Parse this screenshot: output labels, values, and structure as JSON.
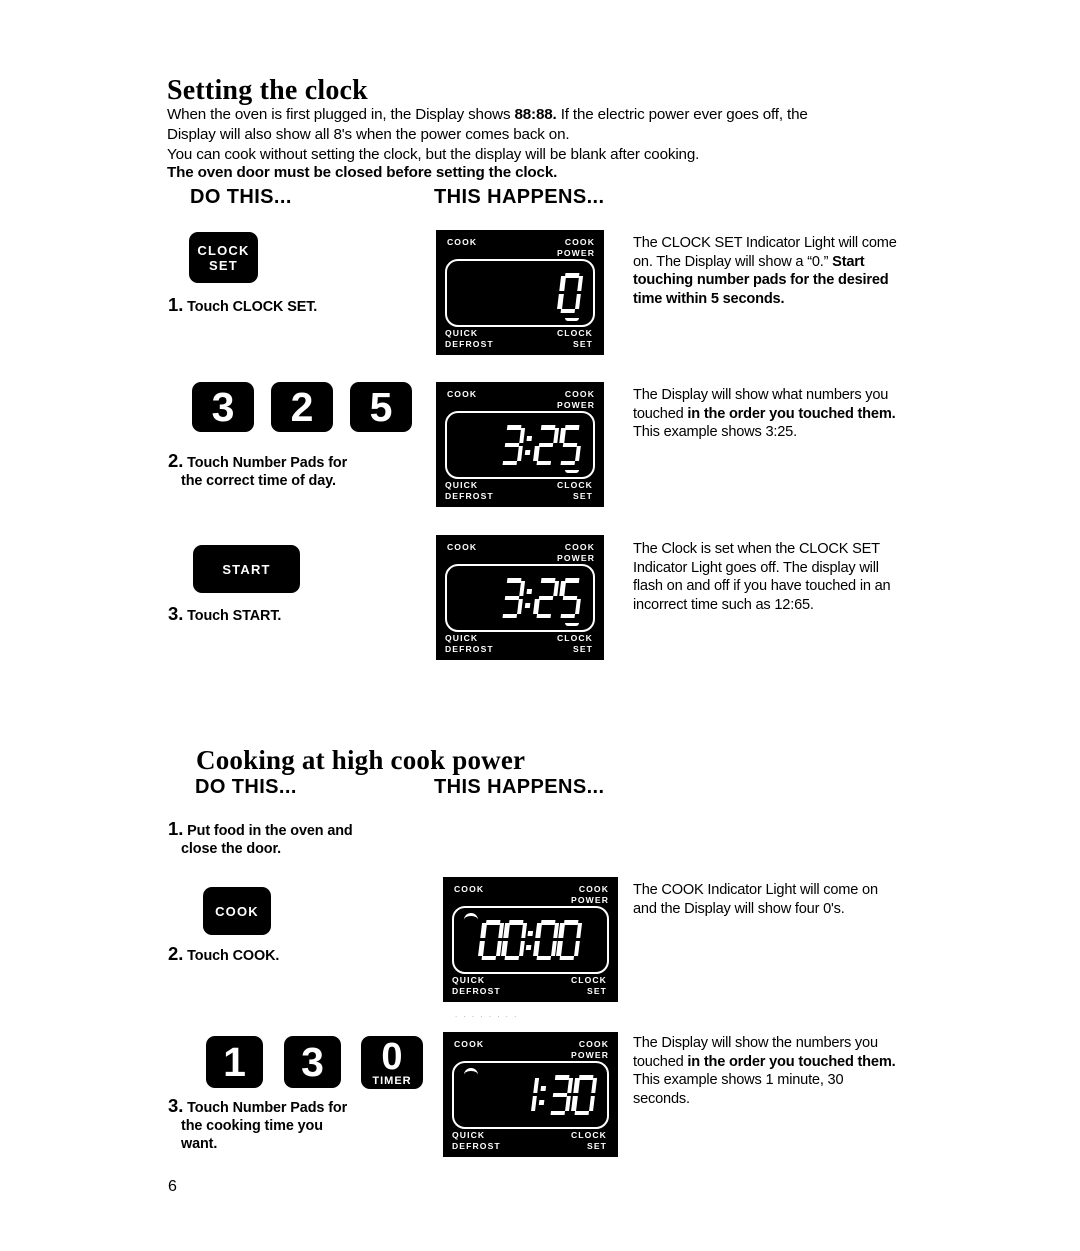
{
  "page": {
    "number": "6",
    "artifact_text": ". .   .     . .           .      .            ."
  },
  "sections": [
    {
      "id": "setting-the-clock",
      "title": "Setting the clock",
      "intro": [
        "When the oven is first plugged in, the Display shows 88:88. If the electric power ever goes off, the Display will also show all 8's when the power comes back on.",
        "You can cook without setting the clock, but the display will be blank after cooking.",
        "The oven door must be closed before setting the clock."
      ],
      "intro_bold_fragment": "88:88.",
      "columns": {
        "do_this": "DO THIS...",
        "this_happens": "THIS HAPPENS..."
      },
      "steps": [
        {
          "number": "1.",
          "caption": "Touch CLOCK SET.",
          "caption_line2": "",
          "caption_line3": "",
          "control": {
            "kind": "word-pad",
            "label": "CLOCK\nSET"
          },
          "display": {
            "top_left": "COOK",
            "top_right": "COOK\nPOWER",
            "bottom_left": "QUICK\nDEFROST",
            "bottom_right": "CLOCK\nSET",
            "readout": "0",
            "readout_mode": "right",
            "colon": true,
            "under_tick": true,
            "curve_tick": false
          },
          "happens": {
            "plain_1": "The CLOCK SET Indicator Light will come on. The Display will show a “0.” ",
            "bold_1": "Start touching number pads for the desired time within 5 seconds.",
            "plain_2": ""
          }
        },
        {
          "number": "2.",
          "caption": "Touch Number Pads for",
          "caption_line2": "the correct time of day.",
          "caption_line3": "",
          "control": {
            "kind": "digit-pads",
            "pads": [
              "3",
              "2",
              "5"
            ]
          },
          "display": {
            "top_left": "COOK",
            "top_right": "COOK\nPOWER",
            "bottom_left": "QUICK\nDEFROST",
            "bottom_right": "CLOCK\nSET",
            "readout": "3:25",
            "readout_mode": "right",
            "colon": true,
            "under_tick": true,
            "curve_tick": false
          },
          "happens": {
            "plain_1": "The Display will show what numbers you touched ",
            "bold_1": "in the order you touched them.",
            "plain_2": " This example shows 3:25."
          }
        },
        {
          "number": "3.",
          "caption": "Touch START.",
          "caption_line2": "",
          "caption_line3": "",
          "control": {
            "kind": "word-pad-wide",
            "label": "START"
          },
          "display": {
            "top_left": "COOK",
            "top_right": "COOK\nPOWER",
            "bottom_left": "QUICK\nDEFROST",
            "bottom_right": "CLOCK\nSET",
            "readout": "3:25",
            "readout_mode": "right",
            "colon": true,
            "under_tick": true,
            "curve_tick": false
          },
          "happens": {
            "plain_1": "The Clock is set when the CLOCK SET Indicator Light goes off. The display will flash on and off if you have touched in an incorrect time such as 12:65.",
            "bold_1": "",
            "plain_2": ""
          }
        }
      ]
    },
    {
      "id": "cooking-at-high-cook-power",
      "title": "Cooking at high cook power",
      "columns": {
        "do_this": "DO THIS...",
        "this_happens": "THIS HAPPENS..."
      },
      "steps": [
        {
          "number": "1.",
          "caption": "Put food in the oven and",
          "caption_line2": "close the door.",
          "caption_line3": "",
          "control": {
            "kind": "none"
          },
          "display": null,
          "happens": null
        },
        {
          "number": "2.",
          "caption": "Touch COOK.",
          "caption_line2": "",
          "caption_line3": "",
          "control": {
            "kind": "word-pad",
            "label": "COOK"
          },
          "display": {
            "top_left": "COOK",
            "top_right": "COOK\nPOWER",
            "bottom_left": "QUICK\nDEFROST",
            "bottom_right": "CLOCK\nSET",
            "readout": "00:00",
            "readout_mode": "full",
            "colon": true,
            "under_tick": false,
            "curve_tick": true
          },
          "happens": {
            "plain_1": "The COOK Indicator Light will come on and the Display will show four 0's.",
            "bold_1": "",
            "plain_2": ""
          }
        },
        {
          "number": "3.",
          "caption": "Touch Number Pads for",
          "caption_line2": "the cooking time you",
          "caption_line3": "want.",
          "control": {
            "kind": "digit-pads",
            "pads": [
              "1",
              "3",
              "0"
            ],
            "last_pad_sublabel": "TIMER"
          },
          "display": {
            "top_left": "COOK",
            "top_right": "COOK\nPOWER",
            "bottom_left": "QUICK\nDEFROST",
            "bottom_right": "CLOCK\nSET",
            "readout": "1:30",
            "readout_mode": "right",
            "colon": true,
            "under_tick": false,
            "curve_tick": true
          },
          "happens": {
            "plain_1": "The Display will show the numbers you touched ",
            "bold_1": "in the order you touched them.",
            "plain_2": " This example shows 1 minute, 30 seconds."
          }
        }
      ]
    }
  ]
}
